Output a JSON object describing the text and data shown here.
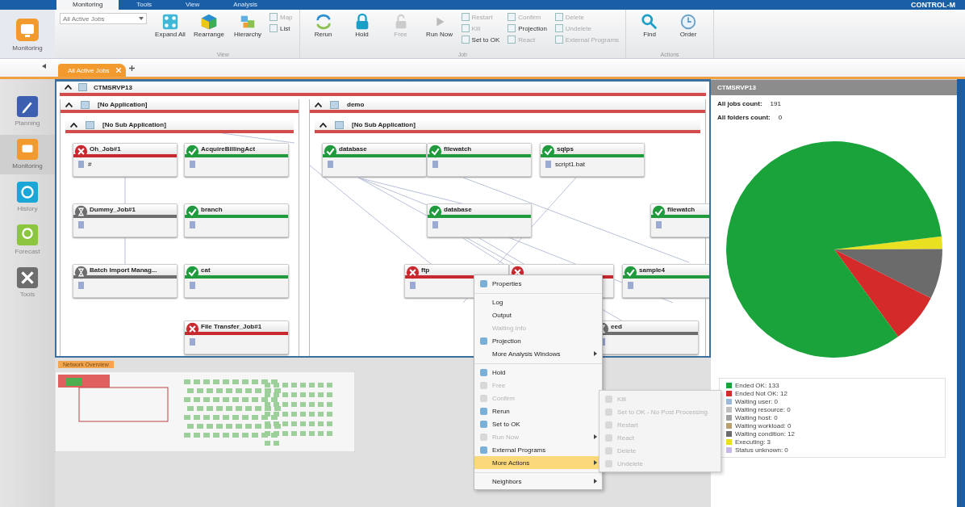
{
  "top_bar": {
    "tabs": [
      {
        "label": "Monitoring",
        "selected": true
      },
      {
        "label": "Tools",
        "selected": false
      },
      {
        "label": "View",
        "selected": false
      },
      {
        "label": "Analysis",
        "selected": false
      }
    ],
    "brand": "CONTROL-M"
  },
  "app_button": {
    "label": "Monitoring"
  },
  "ribbon": {
    "filter": {
      "value": "All Active Jobs"
    },
    "groups": [
      {
        "label": "View",
        "items": [
          {
            "label": "Expand All",
            "kind": "large",
            "disabled": false
          },
          {
            "label": "Rearrange",
            "kind": "large",
            "disabled": false
          },
          {
            "label": "Hierarchy",
            "kind": "large",
            "disabled": false
          },
          {
            "label": "Map",
            "kind": "small",
            "disabled": true
          },
          {
            "label": "List",
            "kind": "small",
            "disabled": false
          }
        ]
      },
      {
        "label": "Job",
        "items": [
          {
            "label": "Rerun",
            "kind": "large",
            "disabled": false
          },
          {
            "label": "Hold",
            "kind": "large",
            "disabled": false
          },
          {
            "label": "Free",
            "kind": "large",
            "disabled": true
          },
          {
            "label": "Run Now",
            "kind": "large",
            "disabled": false
          },
          {
            "label": "Restart",
            "kind": "small",
            "disabled": true
          },
          {
            "label": "Kill",
            "kind": "small",
            "disabled": true
          },
          {
            "label": "Set to OK",
            "kind": "small",
            "disabled": false
          },
          {
            "label": "Confirm",
            "kind": "small",
            "disabled": true
          },
          {
            "label": "Projection",
            "kind": "small",
            "disabled": false
          },
          {
            "label": "React",
            "kind": "small",
            "disabled": true
          },
          {
            "label": "Delete",
            "kind": "small",
            "disabled": true
          },
          {
            "label": "Undelete",
            "kind": "small",
            "disabled": true
          },
          {
            "label": "External Programs",
            "kind": "small",
            "disabled": true
          }
        ]
      },
      {
        "label": "Actions",
        "items": [
          {
            "label": "Find",
            "kind": "large",
            "disabled": false
          },
          {
            "label": "Order",
            "kind": "large",
            "disabled": false
          }
        ]
      }
    ]
  },
  "doc_tabs": [
    {
      "label": "All Active Jobs",
      "selected": true
    }
  ],
  "sidebar": {
    "items": [
      {
        "label": "Planning",
        "selected": false
      },
      {
        "label": "Monitoring",
        "selected": true
      },
      {
        "label": "History",
        "selected": false
      },
      {
        "label": "Forecast",
        "selected": false
      },
      {
        "label": "Tools",
        "selected": false
      }
    ]
  },
  "canvas": {
    "server": "CTMSRVP13",
    "applications": [
      {
        "name": "[No Application]",
        "sub_application": "[No Sub Application]",
        "jobs": [
          {
            "name": "Oh_Job#1",
            "kind": "failed",
            "detail": "#"
          },
          {
            "name": "AcquireBillingAct",
            "kind": "ok"
          },
          {
            "name": "Dummy_Job#1",
            "kind": "waiting"
          },
          {
            "name": "branch",
            "kind": "ok"
          },
          {
            "name": "Batch Import Manag...",
            "kind": "waiting"
          },
          {
            "name": "cat",
            "kind": "ok"
          },
          {
            "name": "File Transfer_Job#1",
            "kind": "failed"
          }
        ]
      },
      {
        "name": "demo",
        "sub_application": "[No Sub Application]",
        "jobs": [
          {
            "name": "database",
            "kind": "ok"
          },
          {
            "name": "filewatch",
            "kind": "ok"
          },
          {
            "name": "sqlps",
            "kind": "ok",
            "detail": "script1.bat"
          },
          {
            "name": "database",
            "kind": "ok"
          },
          {
            "name": "filewatch",
            "kind": "ok"
          },
          {
            "name": "ftp",
            "kind": "failed"
          },
          {
            "kind": "failed"
          },
          {
            "name": "sample4",
            "kind": "ok"
          },
          {
            "name": "eed",
            "kind": "waiting"
          }
        ]
      }
    ]
  },
  "overview": {
    "title": "Network Overview"
  },
  "context_menu": {
    "items": [
      {
        "label": "Properties",
        "disabled": false,
        "icon": true,
        "submenu": false,
        "selected": false,
        "separator_before": false
      },
      {
        "label": "Log",
        "disabled": false,
        "icon": false,
        "submenu": false,
        "selected": false,
        "separator_before": true
      },
      {
        "label": "Output",
        "disabled": false,
        "icon": false,
        "submenu": false,
        "selected": false,
        "separator_before": false
      },
      {
        "label": "Waiting Info",
        "disabled": true,
        "icon": false,
        "submenu": false,
        "selected": false,
        "separator_before": false
      },
      {
        "label": "Projection",
        "disabled": false,
        "icon": true,
        "submenu": false,
        "selected": false,
        "separator_before": false
      },
      {
        "label": "More Analysis Windows",
        "disabled": false,
        "icon": false,
        "submenu": true,
        "selected": false,
        "separator_before": false
      },
      {
        "label": "Hold",
        "disabled": false,
        "icon": true,
        "submenu": false,
        "selected": false,
        "separator_before": true
      },
      {
        "label": "Free",
        "disabled": true,
        "icon": true,
        "submenu": false,
        "selected": false,
        "separator_before": false
      },
      {
        "label": "Confirm",
        "disabled": true,
        "icon": true,
        "submenu": false,
        "selected": false,
        "separator_before": false
      },
      {
        "label": "Rerun",
        "disabled": false,
        "icon": true,
        "submenu": false,
        "selected": false,
        "separator_before": false
      },
      {
        "label": "Set to OK",
        "disabled": false,
        "icon": true,
        "submenu": false,
        "selected": false,
        "separator_before": false
      },
      {
        "label": "Run Now",
        "disabled": true,
        "icon": true,
        "submenu": true,
        "selected": false,
        "separator_before": false
      },
      {
        "label": "External Programs",
        "disabled": false,
        "icon": true,
        "submenu": false,
        "selected": false,
        "separator_before": false
      },
      {
        "label": "More Actions",
        "disabled": false,
        "icon": false,
        "submenu": true,
        "selected": true,
        "separator_before": false
      },
      {
        "label": "Neighbors",
        "disabled": false,
        "icon": false,
        "submenu": true,
        "selected": false,
        "separator_before": true
      }
    ]
  },
  "submenu": {
    "items": [
      {
        "label": "Kill",
        "disabled": true
      },
      {
        "label": "Set to OK - No Post Processing",
        "disabled": true
      },
      {
        "label": "Restart",
        "disabled": true
      },
      {
        "label": "React",
        "disabled": true
      },
      {
        "label": "Delete",
        "disabled": true
      },
      {
        "label": "Undelete",
        "disabled": true
      }
    ]
  },
  "summary": {
    "title": "CTMSRVP13",
    "stats": [
      {
        "label": "All jobs count:",
        "value": "191"
      },
      {
        "label": "All folders count:",
        "value": "0"
      }
    ],
    "chart_data": {
      "type": "pie",
      "categories": [
        "Ended OK: 133",
        "Ended Not OK: 12",
        "Waiting user: 0",
        "Waiting resource: 0",
        "Waiting host: 0",
        "Waiting workload: 0",
        "Waiting condition: 12",
        "Executing: 3",
        "Status unknown: 0"
      ],
      "values": [
        133,
        12,
        0,
        0,
        0,
        0,
        12,
        3,
        0
      ]
    },
    "legend": [
      {
        "color": "#1aa33a"
      },
      {
        "color": "#d42a2a"
      },
      {
        "color": "#9fb8d8"
      },
      {
        "color": "#c0c0c0"
      },
      {
        "color": "#a0a0a0"
      },
      {
        "color": "#b8a070"
      },
      {
        "color": "#6b6b6b"
      },
      {
        "color": "#e8e020"
      },
      {
        "color": "#c8b8e8"
      }
    ]
  }
}
